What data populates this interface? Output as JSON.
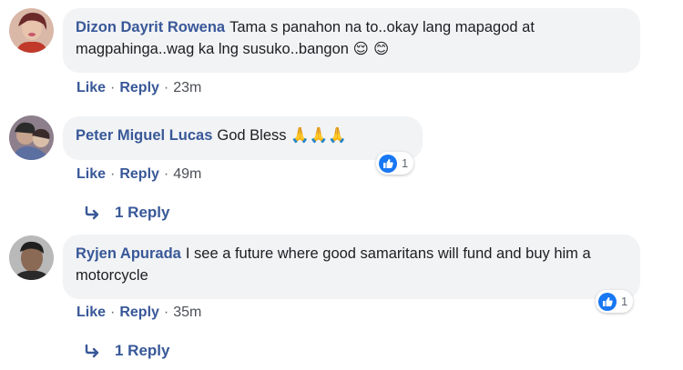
{
  "comments": [
    {
      "author": "Dizon Dayrit Rowena",
      "text": "Tama s panahon na to..okay lang mapagod at magpahinga..wag ka lng susuko..bangon",
      "emoji": "😌 😊",
      "actions": {
        "like": "Like",
        "reply": "Reply",
        "time": "23m"
      }
    },
    {
      "author": "Peter Miguel Lucas",
      "text": "God Bless",
      "emoji": "🙏🙏🙏",
      "actions": {
        "like": "Like",
        "reply": "Reply",
        "time": "49m"
      },
      "reactions": {
        "icon": "like-icon",
        "count": "1"
      },
      "replies_label": "1 Reply"
    },
    {
      "author": "Ryjen Apurada",
      "text": "I see a future where good samaritans will fund and buy him a motorcycle",
      "actions": {
        "like": "Like",
        "reply": "Reply",
        "time": "35m"
      },
      "reactions": {
        "icon": "like-icon",
        "count": "1"
      },
      "replies_label": "1 Reply"
    }
  ],
  "separator": "·",
  "colors": {
    "author": "#385898",
    "bubble": "#f2f3f5",
    "like_badge": "#1877f2"
  }
}
